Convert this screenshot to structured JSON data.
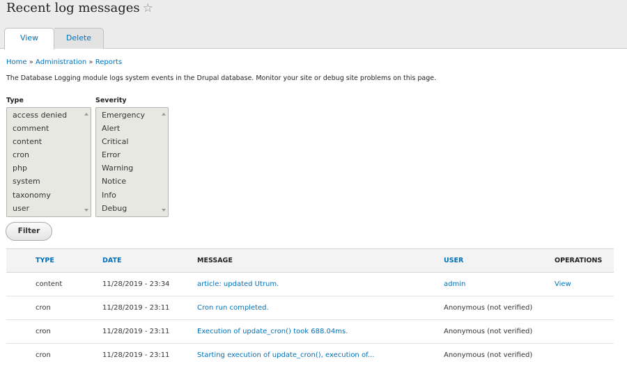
{
  "page": {
    "title": "Recent log messages",
    "star_icon": "☆"
  },
  "tabs": [
    {
      "label": "View"
    },
    {
      "label": "Delete"
    }
  ],
  "breadcrumb": {
    "items": [
      "Home",
      "Administration",
      "Reports"
    ],
    "separator": "»"
  },
  "description": "The Database Logging module logs system events in the Drupal database. Monitor your site or debug site problems on this page.",
  "filters": {
    "type": {
      "label": "Type",
      "options": [
        "access denied",
        "comment",
        "content",
        "cron",
        "php",
        "system",
        "taxonomy",
        "user"
      ]
    },
    "severity": {
      "label": "Severity",
      "options": [
        "Emergency",
        "Alert",
        "Critical",
        "Error",
        "Warning",
        "Notice",
        "Info",
        "Debug"
      ]
    },
    "filter_button": "Filter"
  },
  "table": {
    "headers": {
      "type": "TYPE",
      "date": "DATE",
      "message": "MESSAGE",
      "user": "USER",
      "operations": "OPERATIONS"
    },
    "rows": [
      {
        "type": "content",
        "date": "11/28/2019 - 23:34",
        "message": "article: updated Utrum.",
        "user": "admin",
        "operations": "View"
      },
      {
        "type": "cron",
        "date": "11/28/2019 - 23:11",
        "message": "Cron run completed.",
        "user": "Anonymous (not verified)",
        "operations": ""
      },
      {
        "type": "cron",
        "date": "11/28/2019 - 23:11",
        "message": "Execution of update_cron() took 688.04ms.",
        "user": "Anonymous (not verified)",
        "operations": ""
      },
      {
        "type": "cron",
        "date": "11/28/2019 - 23:11",
        "message": "Starting execution of update_cron(), execution of...",
        "user": "Anonymous (not verified)",
        "operations": ""
      }
    ]
  },
  "colors": {
    "link": "#0071b8",
    "header_bg": "#ececec",
    "listbox_bg": "#e8e8e3"
  }
}
